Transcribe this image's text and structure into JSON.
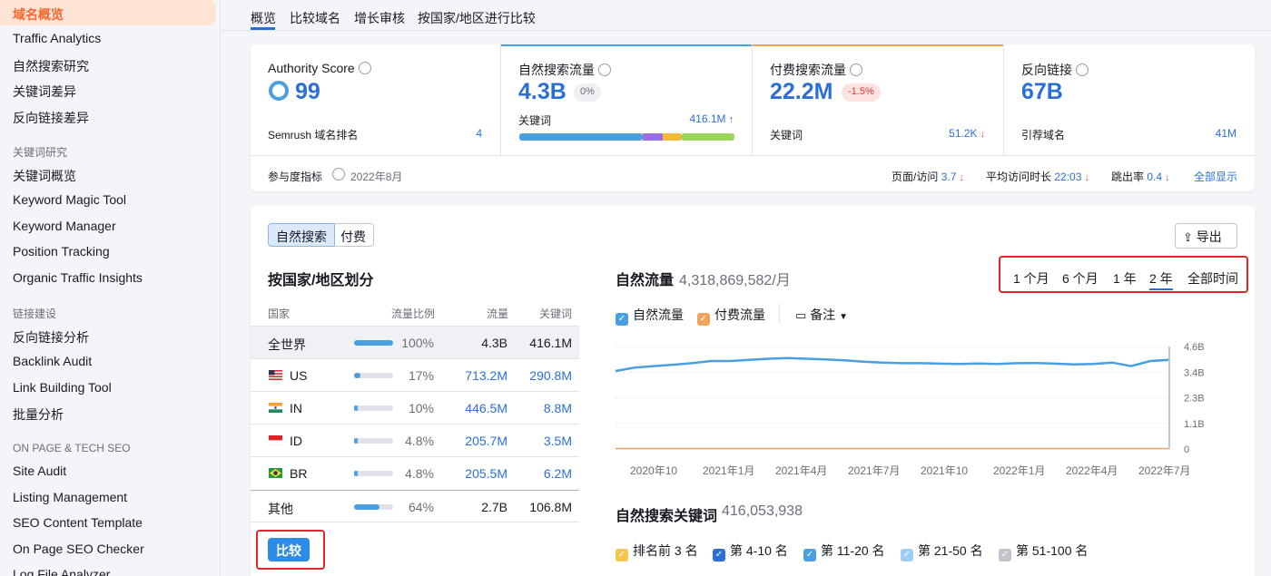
{
  "sidebar": {
    "active_item": "域名概览",
    "items_top": [
      "Traffic Analytics",
      "自然搜索研究",
      "关键词差异",
      "反向链接差异"
    ],
    "section_keyword": "关键词研究",
    "items_keyword": [
      "关键词概览",
      "Keyword Magic Tool",
      "Keyword Manager",
      "Position Tracking",
      "Organic Traffic Insights"
    ],
    "section_link": "链接建设",
    "items_link": [
      "反向链接分析",
      "Backlink Audit",
      "Link Building Tool",
      "批量分析"
    ],
    "section_onpage": "ON PAGE & TECH SEO",
    "items_onpage": [
      "Site Audit",
      "Listing Management",
      "SEO Content Template",
      "On Page SEO Checker",
      "Log File Analyzer"
    ]
  },
  "tabs": [
    "概览",
    "比较域名",
    "增长审核",
    "按国家/地区进行比较"
  ],
  "metrics": {
    "authority": {
      "label": "Authority Score",
      "value": "99",
      "sub_label": "Semrush 域名排名",
      "sub_value": "4"
    },
    "organic": {
      "label": "自然搜索流量",
      "value": "4.3B",
      "badge": "0%",
      "sub_label": "关键词",
      "sub_value": "416.1M"
    },
    "paid": {
      "label": "付费搜索流量",
      "value": "22.2M",
      "badge": "-1.5%",
      "sub_label": "关键词",
      "sub_value": "51.2K"
    },
    "backlinks": {
      "label": "反向链接",
      "value": "67B",
      "sub_label": "引荐域名",
      "sub_value": "41M"
    }
  },
  "engagement": {
    "label": "参与度指标",
    "date": "2022年8月",
    "pages_label": "页面/访问",
    "pages_value": "3.7",
    "duration_label": "平均访问时长",
    "duration_value": "22:03",
    "bounce_label": "跳出率",
    "bounce_value": "0.4",
    "show_all": "全部显示"
  },
  "segment": {
    "organic": "自然搜索",
    "paid": "付费"
  },
  "export_label": "导出",
  "country_table": {
    "title": "按国家/地区划分",
    "headers": [
      "国家",
      "流量比例",
      "流量",
      "关键词"
    ],
    "rows": [
      {
        "country": "全世界",
        "share": "100%",
        "share_value": 100,
        "traffic": "4.3B",
        "keywords": "416.1M"
      },
      {
        "country": "US",
        "share": "17%",
        "share_value": 17,
        "traffic": "713.2M",
        "keywords": "290.8M"
      },
      {
        "country": "IN",
        "share": "10%",
        "share_value": 10,
        "traffic": "446.5M",
        "keywords": "8.8M"
      },
      {
        "country": "ID",
        "share": "4.8%",
        "share_value": 4.8,
        "traffic": "205.7M",
        "keywords": "3.5M"
      },
      {
        "country": "BR",
        "share": "4.8%",
        "share_value": 4.8,
        "traffic": "205.5M",
        "keywords": "6.2M"
      },
      {
        "country": "其他",
        "share": "64%",
        "share_value": 64,
        "traffic": "2.7B",
        "keywords": "106.8M"
      }
    ],
    "compare_button": "比较"
  },
  "traffic_chart_header": {
    "title": "自然流量",
    "value": "4,318,869,582/月",
    "ranges": [
      "1 个月",
      "6 个月",
      "1 年",
      "2 年",
      "全部时间"
    ],
    "active_range": "2 年",
    "legend_organic": "自然流量",
    "legend_paid": "付费流量",
    "notes": "备注"
  },
  "keywords_section": {
    "title": "自然搜索关键词",
    "value": "416,053,938",
    "legend": [
      "排名前 3 名",
      "第 4-10 名",
      "第 11-20 名",
      "第 21-50 名",
      "第 51-100 名"
    ]
  },
  "colors": {
    "accent": "#2b6fd6",
    "brand": "#ff642d",
    "organic_line": "#4a9fe0",
    "paid_line": "#f2a35b",
    "alert": "#e0262c"
  },
  "chart_data": {
    "type": "line",
    "x": [
      "2020年10",
      "2021年1月",
      "2021年4月",
      "2021年7月",
      "2021年10",
      "2022年1月",
      "2022年4月",
      "2022年7月"
    ],
    "yticks": [
      "0",
      "1.1B",
      "2.3B",
      "3.4B",
      "4.6B"
    ],
    "ylim": [
      0,
      4.6
    ],
    "series": [
      {
        "name": "自然流量",
        "color": "#4a9fe0",
        "values": [
          3.5,
          3.65,
          3.72,
          3.78,
          3.85,
          3.95,
          3.95,
          4.0,
          4.05,
          4.08,
          4.05,
          4.02,
          3.98,
          3.92,
          3.88,
          3.85,
          3.85,
          3.83,
          3.82,
          3.84,
          3.82,
          3.85,
          3.86,
          3.83,
          3.8,
          3.82,
          3.88,
          3.72,
          3.95,
          4.0
        ]
      },
      {
        "name": "付费流量",
        "color": "#f2a35b",
        "values": [
          0.02,
          0.02,
          0.02,
          0.02,
          0.02,
          0.02,
          0.02,
          0.02,
          0.02,
          0.02,
          0.02,
          0.02,
          0.02,
          0.02,
          0.02,
          0.02,
          0.02,
          0.02,
          0.02,
          0.02,
          0.02,
          0.02,
          0.02,
          0.02,
          0.02,
          0.02,
          0.02,
          0.02,
          0.02,
          0.02
        ]
      }
    ]
  }
}
